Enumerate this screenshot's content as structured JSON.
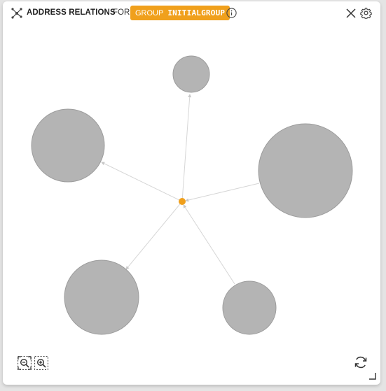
{
  "header": {
    "title": "ADDRESS RELATIONS",
    "for_label": "FOR",
    "group_badge": {
      "kind": "GROUP",
      "name": "INITIALGROUP"
    },
    "icons": {
      "graph": "graph-network-icon",
      "info": "info-icon",
      "close": "close-icon",
      "settings": "gear-icon"
    }
  },
  "graph": {
    "center_node_color": "#f0a01c",
    "node_color": "#b4b4b4",
    "node_stroke": "#9a9a9a",
    "edge_color": "#d0d0d0"
  },
  "footer": {
    "icons": {
      "zoom_out": "zoom-out-icon",
      "zoom_in": "zoom-in-icon",
      "refresh": "refresh-icon",
      "resize": "resize-handle-icon"
    }
  },
  "colors": {
    "accent": "#f0a01c",
    "panel_bg": "#ffffff",
    "page_bg": "#e4e4e4",
    "text": "#222222"
  }
}
